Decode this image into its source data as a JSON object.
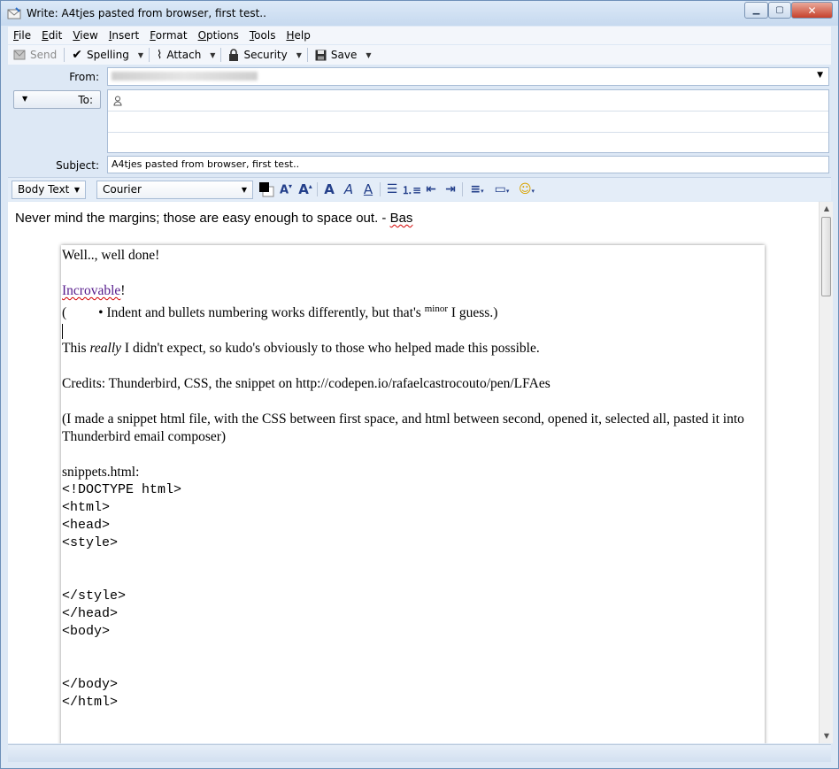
{
  "window": {
    "title": "Write: A4tjes pasted from browser, first test.."
  },
  "menu": [
    "File",
    "Edit",
    "View",
    "Insert",
    "Format",
    "Options",
    "Tools",
    "Help"
  ],
  "toolbar": {
    "send": "Send",
    "spelling": "Spelling",
    "attach": "Attach",
    "security": "Security",
    "save": "Save"
  },
  "headers": {
    "from_label": "From:",
    "from_value": "",
    "to_label": "To:",
    "subject_label": "Subject:",
    "subject_value": "A4tjes pasted from browser, first test.."
  },
  "format": {
    "paragraph_style": "Body Text",
    "font": "Courier"
  },
  "message": {
    "intro": "Never mind the margins; those are easy enough to space out. - ",
    "signature": "Bas",
    "line1": "Well.., well done!",
    "incro": "Incrovable",
    "excl": "!",
    "bullet_pre": "(",
    "bullet_text": "• Indent and bullets numbering works differently, but that's",
    "minor": "minor",
    "bullet_post": " I guess.)",
    "p_this": "This ",
    "p_really": "really",
    "p_rest": " I didn't expect, so kudo's obviously to those who helped made this possible.",
    "credits": "Credits: Thunderbird, CSS, the snippet on http://codepen.io/rafaelcastrocouto/pen/LFAes",
    "made": "(I made a snippet html file, with the CSS between first space, and html between second, opened it, selected all, pasted it into Thunderbird email composer)",
    "snippets": "snippets.html:",
    "code": [
      "<!DOCTYPE html>",
      "<html>",
      "<head>",
      "<style>",
      "",
      "",
      "</style>",
      "</head>",
      "<body>",
      "",
      "",
      "</body>",
      "</html>"
    ]
  }
}
